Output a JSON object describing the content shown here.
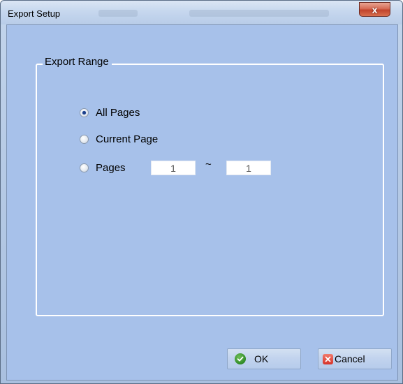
{
  "window": {
    "title": "Export Setup",
    "close_glyph": "x"
  },
  "group": {
    "legend": "Export Range",
    "options": [
      {
        "label": "All Pages",
        "selected": true
      },
      {
        "label": "Current Page",
        "selected": false
      },
      {
        "label": "Pages",
        "selected": false
      }
    ],
    "range": {
      "from": "1",
      "separator": "~",
      "to": "1"
    }
  },
  "buttons": {
    "ok": "OK",
    "cancel": "Cancel",
    "ok_icon": "check-icon",
    "cancel_icon": "x-icon"
  },
  "colors": {
    "client_bg": "#a7c1ea",
    "close_red": "#c1432b",
    "ok_green": "#2e8a25",
    "cancel_red": "#d6332a"
  }
}
